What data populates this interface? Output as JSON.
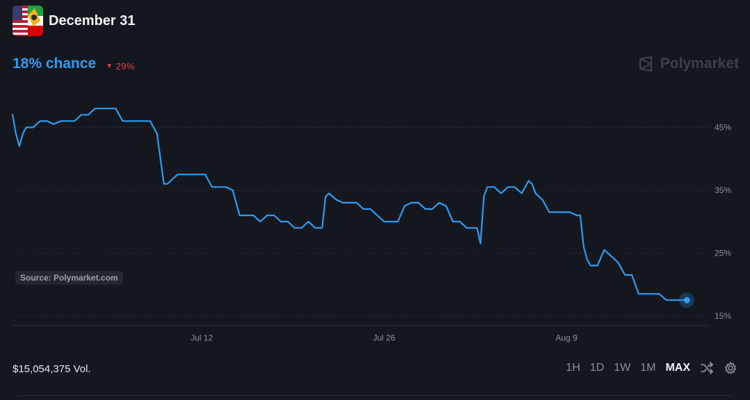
{
  "header": {
    "title": "December 31",
    "avatar_icon": "us-iran-flag-icon"
  },
  "probability": {
    "label": "18% chance",
    "change": "29%",
    "change_icon": "down-triangle-icon",
    "color": "#2e9cf2",
    "change_color": "#e2414b"
  },
  "brand": {
    "name": "Polymarket",
    "icon": "polymarket-logo-icon"
  },
  "source": {
    "label": "Source: Polymarket.com"
  },
  "footer": {
    "volume": "$15,054,375 Vol.",
    "timeframes": [
      {
        "label": "1H",
        "active": false
      },
      {
        "label": "1D",
        "active": false
      },
      {
        "label": "1W",
        "active": false
      },
      {
        "label": "1M",
        "active": false
      },
      {
        "label": "MAX",
        "active": true
      }
    ]
  },
  "chart_data": {
    "type": "line",
    "ylim": [
      12,
      52
    ],
    "yticks": [
      45,
      35,
      25,
      15
    ],
    "ytick_labels": [
      "45%",
      "35%",
      "25%",
      "15%"
    ],
    "xlim": [
      0,
      100
    ],
    "xticks": [
      {
        "x": 27.5,
        "label": "Jul 12"
      },
      {
        "x": 54.0,
        "label": "Jul 26"
      },
      {
        "x": 80.5,
        "label": "Aug 9"
      }
    ],
    "line_color": "#2e9cf2",
    "series": [
      {
        "x": [
          0.0,
          0.5,
          1.0,
          1.5,
          2.0,
          3.0,
          4.0,
          5.0,
          6.0,
          7.0,
          8.0,
          9.0,
          10.0,
          11.0,
          12.0,
          13.0,
          14.0,
          15.0,
          16.0,
          17.0,
          18.0,
          19.0,
          20.0,
          21.0,
          21.5,
          22.0,
          22.5,
          23.0,
          24.0,
          25.0,
          26.0,
          27.0,
          28.0,
          29.0,
          30.0,
          31.0,
          32.0,
          33.0,
          34.0,
          35.0,
          36.0,
          37.0,
          38.0,
          39.0,
          40.0,
          41.0,
          42.0,
          43.0,
          44.0,
          44.5,
          45.0,
          45.5,
          46.0,
          47.0,
          48.0,
          49.0,
          50.0,
          51.0,
          52.0,
          53.0,
          54.0,
          55.0,
          56.0,
          57.0,
          58.0,
          59.0,
          60.0,
          61.0,
          62.0,
          63.0,
          64.0,
          65.0,
          66.0,
          67.0,
          67.5,
          68.0,
          68.5,
          69.0,
          70.0,
          71.0,
          72.0,
          73.0,
          74.0,
          75.0,
          75.5,
          76.0,
          77.0,
          78.0,
          79.0,
          80.0,
          81.0,
          82.0,
          82.5,
          83.0,
          83.5,
          84.0,
          85.0,
          86.0,
          87.0,
          88.0,
          89.0,
          90.0,
          91.0,
          92.0,
          93.0,
          94.0,
          95.0,
          96.0,
          97.0,
          98.0
        ],
        "y": [
          47.0,
          44.0,
          42.0,
          44.0,
          45.0,
          45.0,
          46.0,
          46.0,
          45.5,
          46.0,
          46.0,
          46.0,
          47.0,
          47.0,
          48.0,
          48.0,
          48.0,
          48.0,
          46.0,
          46.0,
          46.0,
          46.0,
          46.0,
          44.0,
          40.0,
          36.0,
          36.0,
          36.5,
          37.5,
          37.5,
          37.5,
          37.5,
          37.5,
          35.5,
          35.5,
          35.5,
          35.0,
          31.0,
          31.0,
          31.0,
          30.0,
          31.0,
          31.0,
          30.0,
          30.0,
          29.0,
          29.0,
          30.0,
          29.0,
          29.0,
          29.0,
          34.0,
          34.5,
          33.5,
          33.0,
          33.0,
          33.0,
          32.0,
          32.0,
          31.0,
          30.0,
          30.0,
          30.0,
          32.5,
          33.0,
          33.0,
          32.0,
          32.0,
          33.0,
          32.5,
          30.0,
          30.0,
          29.0,
          29.0,
          29.0,
          26.5,
          34.0,
          35.5,
          35.5,
          34.5,
          35.5,
          35.5,
          34.5,
          36.5,
          36.0,
          34.5,
          33.5,
          31.5,
          31.5,
          31.5,
          31.5,
          31.0,
          31.0,
          26.0,
          24.0,
          23.0,
          23.0,
          25.5,
          24.5,
          23.5,
          21.5,
          21.5,
          18.5,
          18.5,
          18.5,
          18.5,
          17.5,
          17.5,
          17.5,
          17.5
        ]
      }
    ],
    "grid": "dotted-horizontal",
    "end_marker": true
  }
}
